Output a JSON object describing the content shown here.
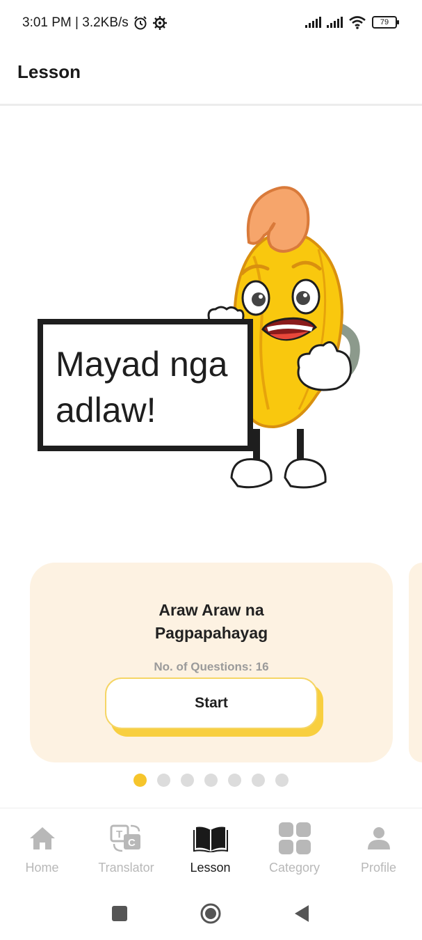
{
  "status_bar": {
    "time_speed": "3:01 PM | 3.2KB/s",
    "battery": "79",
    "icons": [
      "alarm-icon",
      "settings-gear-icon",
      "signal-icon",
      "signal-icon",
      "wifi-icon",
      "battery-icon"
    ]
  },
  "header": {
    "title": "Lesson"
  },
  "illustration": {
    "sign_line1": "Mayad nga",
    "sign_line2": "adlaw!"
  },
  "lesson_card": {
    "title_line1": "Araw Araw na",
    "title_line2": "Pagpapahayag",
    "questions_text": "No. of Questions: 16",
    "start_label": "Start"
  },
  "carousel": {
    "total": 7,
    "active_index": 0
  },
  "bottom_nav": {
    "items": [
      {
        "label": "Home",
        "icon": "home-icon"
      },
      {
        "label": "Translator",
        "icon": "translator-icon"
      },
      {
        "label": "Lesson",
        "icon": "book-icon",
        "active": true
      },
      {
        "label": "Category",
        "icon": "grid-icon"
      },
      {
        "label": "Profile",
        "icon": "person-icon"
      }
    ]
  },
  "colors": {
    "accent": "#f6c52b",
    "card_bg": "#fdf2e2",
    "inactive": "#b8b8b8"
  }
}
